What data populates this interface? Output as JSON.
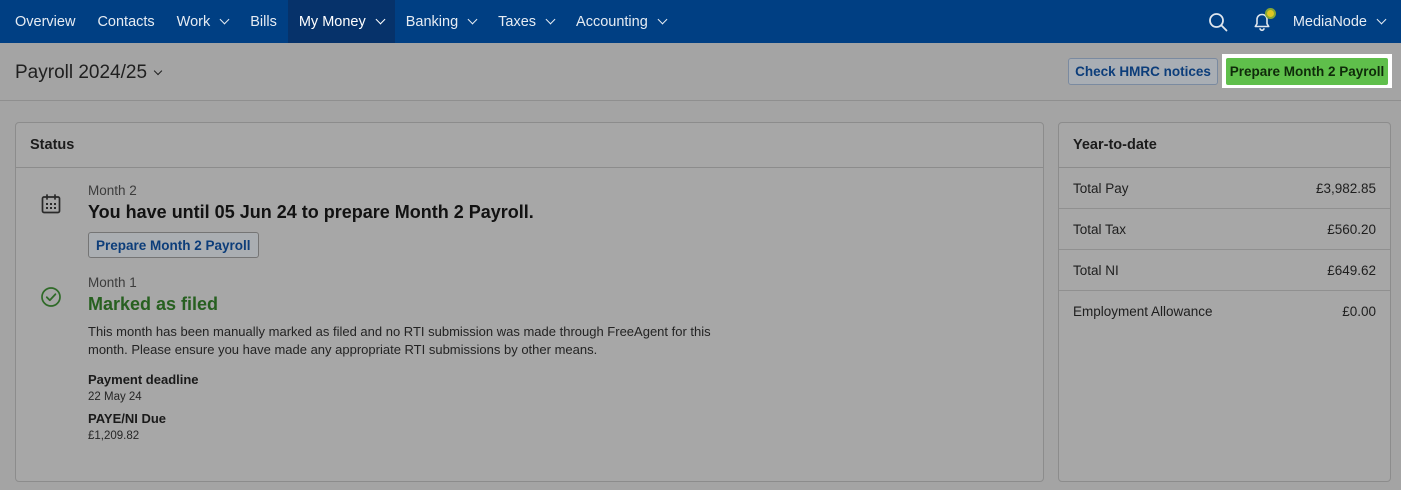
{
  "nav": {
    "items": [
      {
        "label": "Overview",
        "dropdown": false
      },
      {
        "label": "Contacts",
        "dropdown": false
      },
      {
        "label": "Work",
        "dropdown": true
      },
      {
        "label": "Bills",
        "dropdown": false
      },
      {
        "label": "My Money",
        "dropdown": true,
        "active": true
      },
      {
        "label": "Banking",
        "dropdown": true
      },
      {
        "label": "Taxes",
        "dropdown": true
      },
      {
        "label": "Accounting",
        "dropdown": true
      }
    ],
    "search_icon": "search-icon",
    "notification_icon": "bell-icon",
    "user_name": "MediaNode"
  },
  "header": {
    "title": "Payroll 2024/25",
    "check_hmrc_label": "Check HMRC notices",
    "prepare_label": "Prepare Month 2 Payroll"
  },
  "status": {
    "heading": "Status",
    "month2": {
      "icon": "calendar-icon",
      "kicker": "Month 2",
      "heading": "You have until 05 Jun 24 to prepare Month 2 Payroll.",
      "button_label": "Prepare Month 2 Payroll"
    },
    "month1": {
      "icon": "check-circle-icon",
      "kicker": "Month 1",
      "heading": "Marked as filed",
      "description": "This month has been manually marked as filed and no RTI submission was made through FreeAgent for this month. Please ensure you have made any appropriate RTI submissions by other means.",
      "payment_deadline_label": "Payment deadline",
      "payment_deadline_value": "22 May 24",
      "paye_label": "PAYE/NI Due",
      "paye_value": "£1,209.82"
    }
  },
  "ytd": {
    "heading": "Year-to-date",
    "rows": [
      {
        "label": "Total Pay",
        "value": "£3,982.85"
      },
      {
        "label": "Total Tax",
        "value": "£560.20"
      },
      {
        "label": "Total NI",
        "value": "£649.62"
      },
      {
        "label": "Employment Allowance",
        "value": "£0.00"
      }
    ]
  },
  "colors": {
    "nav_bg": "#003f83",
    "primary_button": "#5fbf4b",
    "success_text": "#276020",
    "link_text": "#0c3d7a"
  }
}
